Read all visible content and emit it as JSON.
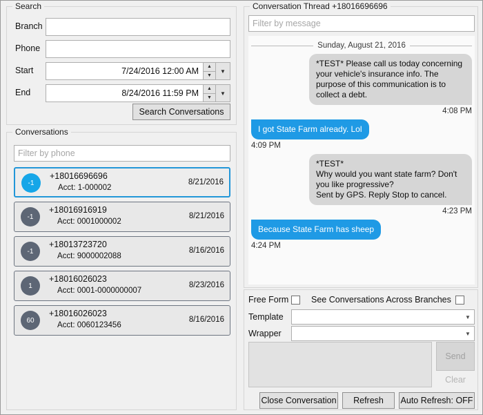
{
  "search": {
    "title": "Search",
    "branch_label": "Branch",
    "branch_value": "",
    "phone_label": "Phone",
    "phone_value": "",
    "start_label": "Start",
    "start_value": "7/24/2016 12:00 AM",
    "end_label": "End",
    "end_value": "8/24/2016 11:59 PM",
    "search_button": "Search Conversations"
  },
  "conversations": {
    "title": "Conversations",
    "filter_placeholder": "Filter by phone",
    "filter_value": "",
    "items": [
      {
        "badge": "-1",
        "phone": "+18016696696",
        "acct": "Acct:  1-000002",
        "date": "8/21/2016",
        "selected": true
      },
      {
        "badge": "-1",
        "phone": "+18016916919",
        "acct": "Acct:  0001000002",
        "date": "8/21/2016",
        "selected": false
      },
      {
        "badge": "-1",
        "phone": "+18013723720",
        "acct": "Acct:  9000002088",
        "date": "8/16/2016",
        "selected": false
      },
      {
        "badge": "1",
        "phone": "+18016026023",
        "acct": "Acct:  0001-0000000007",
        "date": "8/23/2016",
        "selected": false
      },
      {
        "badge": "60",
        "phone": "+18016026023",
        "acct": "Acct:  0060123456",
        "date": "8/16/2016",
        "selected": false
      }
    ]
  },
  "thread": {
    "title": "Conversation Thread +18016696696",
    "filter_placeholder": "Filter by message",
    "filter_value": "",
    "date_divider": "Sunday, August 21, 2016",
    "messages": [
      {
        "direction": "incoming",
        "text": "*TEST* Please call us today concerning your vehicle's insurance info. The purpose of this communication is to collect a debt.",
        "time": "4:08 PM"
      },
      {
        "direction": "outgoing",
        "text": "I got State Farm already.  Lol",
        "time": "4:09 PM"
      },
      {
        "direction": "incoming",
        "text": "*TEST*\nWhy would you want state farm? Don't you like progressive?\n  Sent by GPS.  Reply Stop to cancel.",
        "time": "4:23 PM"
      },
      {
        "direction": "outgoing",
        "text": "Because State Farm has sheep",
        "time": "4:24 PM"
      }
    ]
  },
  "compose": {
    "free_form_label": "Free Form",
    "free_form_checked": false,
    "across_branches_label": "See Conversations Across Branches",
    "across_branches_checked": false,
    "template_label": "Template",
    "template_value": "",
    "wrapper_label": "Wrapper",
    "wrapper_value": "",
    "message_value": "",
    "send_label": "Send",
    "clear_label": "Clear",
    "close_conversation_label": "Close Conversation",
    "refresh_label": "Refresh",
    "auto_refresh_label": "Auto Refresh: OFF"
  },
  "colors": {
    "accent": "#1f9ae5",
    "avatar_selected": "#16a6e8",
    "avatar_default": "#5d6675",
    "incoming_bubble": "#d6d6d6",
    "window_bg": "#f0f0f0"
  }
}
